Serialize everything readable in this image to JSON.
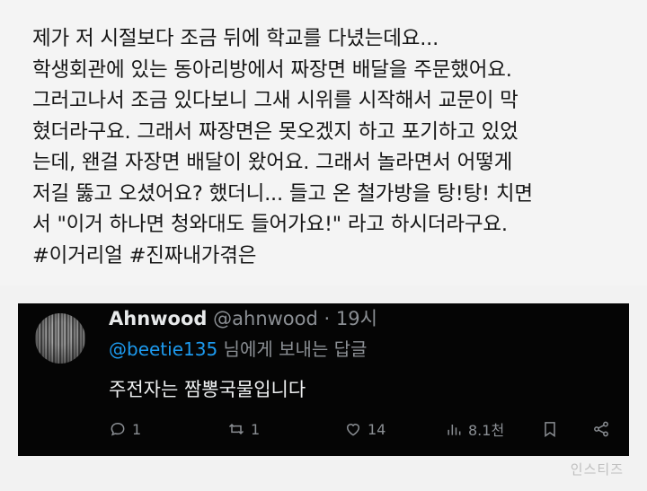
{
  "post": {
    "lines": [
      "제가 저 시절보다 조금 뒤에 학교를 다녔는데요...",
      "학생회관에 있는 동아리방에서 짜장면 배달을 주문했어요.",
      "그러고나서 조금 있다보니 그새 시위를 시작해서 교문이 막",
      "혔더라구요. 그래서 짜장면은 못오겠지 하고 포기하고 있었",
      "는데, 왠걸 자장면 배달이 왔어요. 그래서 놀라면서 어떻게",
      "저길 뚫고 오셨어요? 했더니... 들고 온 철가방을 탕!탕! 치면",
      "서 \"이거 하나면 청와대도 들어가요!\" 라고 하시더라구요.",
      "#이거리얼 #진짜내가겪은"
    ]
  },
  "reply": {
    "display_name": "Ahnwood",
    "handle": "@ahnwood",
    "separator": "·",
    "time": "19시",
    "reply_to_handle": "@beetie135",
    "reply_to_suffix": " 님에게 보내는 답글",
    "text": "주전자는 짬뽕국물입니다",
    "actions": {
      "reply_count": "1",
      "retweet_count": "1",
      "like_count": "14",
      "view_count": "8.1천"
    }
  },
  "watermark": "인스티즈"
}
